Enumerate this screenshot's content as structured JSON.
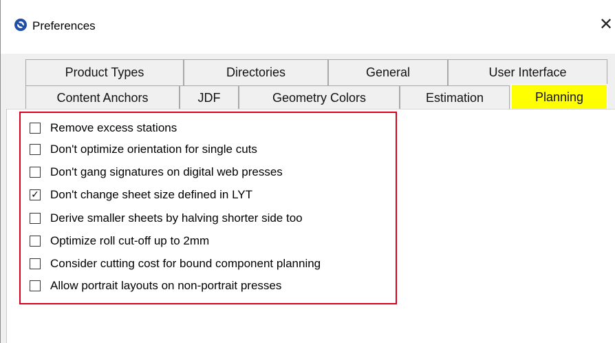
{
  "window": {
    "title": "Preferences",
    "close_glyph": "✕"
  },
  "icons": {
    "app": "gear-globe-icon",
    "close": "close-icon",
    "check": "checkmark-icon"
  },
  "tabs": {
    "row1": [
      {
        "label": "Product Types"
      },
      {
        "label": "Directories"
      },
      {
        "label": "General"
      },
      {
        "label": "User Interface"
      }
    ],
    "row2": [
      {
        "label": "Content Anchors"
      },
      {
        "label": "JDF"
      },
      {
        "label": "Geometry Colors"
      },
      {
        "label": "Estimation"
      },
      {
        "label": "Planning",
        "selected": true
      }
    ]
  },
  "planning": {
    "options": [
      {
        "label": "Remove excess stations",
        "checked": false,
        "mark": ""
      },
      {
        "label": "Don't optimize orientation for single cuts",
        "checked": false,
        "mark": ""
      },
      {
        "label": "Don't gang signatures on digital web presses",
        "checked": false,
        "mark": ""
      },
      {
        "label": "Don't change sheet size defined in LYT",
        "checked": true,
        "mark": "✓"
      },
      {
        "label": "Derive smaller sheets by halving shorter side too",
        "checked": false,
        "mark": ""
      },
      {
        "label": "Optimize roll cut-off up to 2mm",
        "checked": false,
        "mark": ""
      },
      {
        "label": "Consider cutting cost for bound component planning",
        "checked": false,
        "mark": ""
      },
      {
        "label": "Allow portrait layouts on non-portrait presses",
        "checked": false,
        "mark": ""
      }
    ]
  },
  "colors": {
    "selected_tab": "#ffff00",
    "highlight_border": "#d9001b"
  }
}
